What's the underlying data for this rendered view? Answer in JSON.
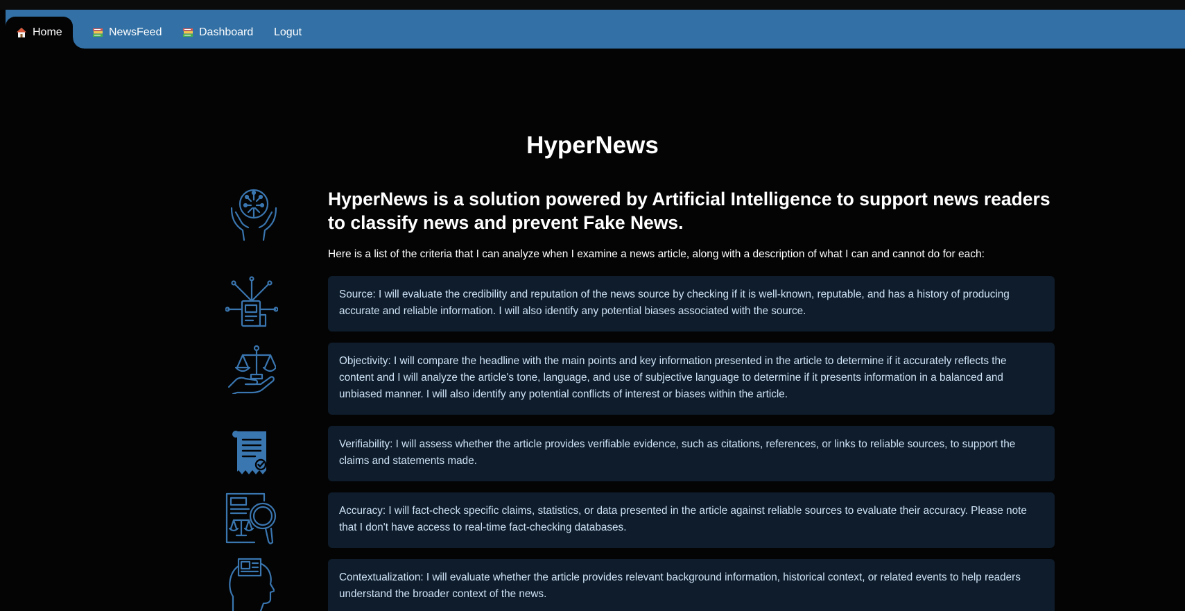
{
  "nav": {
    "items": [
      {
        "label": "Home",
        "icon": "home-icon",
        "active": true
      },
      {
        "label": "NewsFeed",
        "icon": "books-icon",
        "active": false
      },
      {
        "label": "Dashboard",
        "icon": "books-icon",
        "active": false
      },
      {
        "label": "Logut",
        "icon": "",
        "active": false
      }
    ]
  },
  "page": {
    "title": "HyperNews",
    "intro_heading": "HyperNews is a solution powered by Artificial Intelligence to support news readers to classify news and prevent Fake News.",
    "intro_text": "Here is a list of the criteria that I can analyze when I examine a news article, along with a description of what I can and cannot do for each:"
  },
  "criteria": [
    {
      "icon": "ai-brain-hands-icon",
      "text": ""
    },
    {
      "icon": "connected-document-icon",
      "text": "Source: I will evaluate the credibility and reputation of the news source by checking if it is well-known, reputable, and has a history of producing accurate and reliable information. I will also identify any potential biases associated with the source."
    },
    {
      "icon": "justice-scale-hand-icon",
      "text": "Objectivity: I will compare the headline with the main points and key information presented in the article to determine if it accurately reflects the content and I will analyze the article's tone, language, and use of subjective language to determine if it presents information in a balanced and unbiased manner. I will also identify any potential conflicts of interest or biases within the article."
    },
    {
      "icon": "verified-receipt-icon",
      "text": "Verifiability: I will assess whether the article provides verifiable evidence, such as citations, references, or links to reliable sources, to support the claims and statements made."
    },
    {
      "icon": "legal-document-magnifier-icon",
      "text": "Accuracy: I will fact-check specific claims, statistics, or data presented in the article against reliable sources to evaluate their accuracy. Please note that I don't have access to real-time fact-checking databases."
    },
    {
      "icon": "head-document-icon",
      "text": "Contextualization: I will evaluate whether the article provides relevant background information, historical context, or related events to help readers understand the broader context of the news."
    }
  ],
  "colors": {
    "navbar": "#3270a5",
    "background": "#040404",
    "card": "#0e1c2b",
    "card_text": "#cfe3f7",
    "icon": "#3a76b0"
  }
}
